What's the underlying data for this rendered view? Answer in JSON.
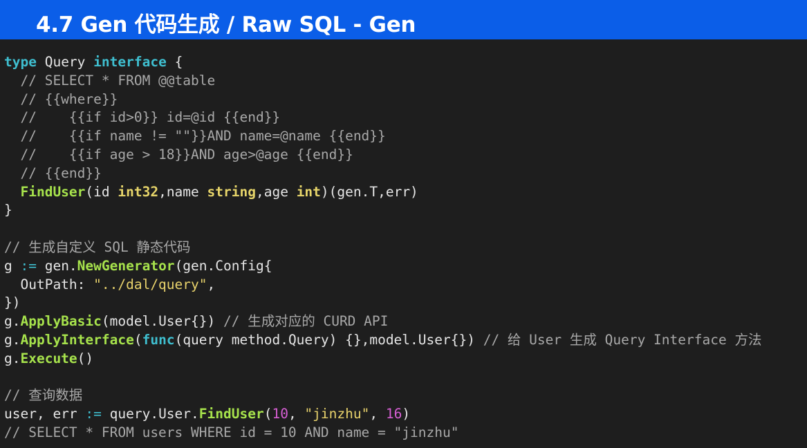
{
  "slide": {
    "title": "4.7 Gen 代码生成 / Raw SQL - Gen"
  },
  "colors": {
    "title_bar": "#0b5ee8",
    "background": "#1e1e1e",
    "keyword": "#3fbfd0",
    "type": "#e7d56a",
    "function": "#a7e34c",
    "comment": "#a9a9a9",
    "string": "#e9d36c",
    "number": "#d75fd4"
  },
  "code": {
    "lines": [
      [
        {
          "t": "kw",
          "v": "type"
        },
        {
          "t": "pl",
          "v": " Query "
        },
        {
          "t": "kw",
          "v": "interface"
        },
        {
          "t": "pl",
          "v": " {"
        }
      ],
      [
        {
          "t": "com",
          "v": "  // SELECT * FROM @@table"
        }
      ],
      [
        {
          "t": "com",
          "v": "  // {{where}}"
        }
      ],
      [
        {
          "t": "com",
          "v": "  //    {{if id>0}} id=@id {{end}}"
        }
      ],
      [
        {
          "t": "com",
          "v": "  //    {{if name != \"\"}}AND name=@name {{end}}"
        }
      ],
      [
        {
          "t": "com",
          "v": "  //    {{if age > 18}}AND age>@age {{end}}"
        }
      ],
      [
        {
          "t": "com",
          "v": "  // {{end}}"
        }
      ],
      [
        {
          "t": "pl",
          "v": "  "
        },
        {
          "t": "fn",
          "v": "FindUser"
        },
        {
          "t": "pl",
          "v": "(id "
        },
        {
          "t": "typ",
          "v": "int32"
        },
        {
          "t": "pl",
          "v": ",name "
        },
        {
          "t": "typ",
          "v": "string"
        },
        {
          "t": "pl",
          "v": ",age "
        },
        {
          "t": "typ",
          "v": "int"
        },
        {
          "t": "pl",
          "v": ")(gen.T,err)"
        }
      ],
      [
        {
          "t": "pl",
          "v": "}"
        }
      ],
      [
        {
          "t": "pl",
          "v": ""
        }
      ],
      [
        {
          "t": "com",
          "v": "// 生成自定义 SQL 静态代码"
        }
      ],
      [
        {
          "t": "pl",
          "v": "g "
        },
        {
          "t": "op",
          "v": ":="
        },
        {
          "t": "pl",
          "v": " gen."
        },
        {
          "t": "fn",
          "v": "NewGenerator"
        },
        {
          "t": "pl",
          "v": "(gen.Config{"
        }
      ],
      [
        {
          "t": "pl",
          "v": "  OutPath: "
        },
        {
          "t": "str",
          "v": "\"../dal/query\""
        },
        {
          "t": "pl",
          "v": ","
        }
      ],
      [
        {
          "t": "pl",
          "v": "})"
        }
      ],
      [
        {
          "t": "pl",
          "v": "g."
        },
        {
          "t": "fn",
          "v": "ApplyBasic"
        },
        {
          "t": "pl",
          "v": "(model.User{}) "
        },
        {
          "t": "com",
          "v": "// 生成对应的 CURD API"
        }
      ],
      [
        {
          "t": "pl",
          "v": "g."
        },
        {
          "t": "fn",
          "v": "ApplyInterface"
        },
        {
          "t": "pl",
          "v": "("
        },
        {
          "t": "kw",
          "v": "func"
        },
        {
          "t": "pl",
          "v": "(query method.Query) {},model.User{}) "
        },
        {
          "t": "com",
          "v": "// 给 User 生成 Query Interface 方法"
        }
      ],
      [
        {
          "t": "pl",
          "v": "g."
        },
        {
          "t": "fn",
          "v": "Execute"
        },
        {
          "t": "pl",
          "v": "()"
        }
      ],
      [
        {
          "t": "pl",
          "v": ""
        }
      ],
      [
        {
          "t": "com",
          "v": "// 查询数据"
        }
      ],
      [
        {
          "t": "pl",
          "v": "user, err "
        },
        {
          "t": "op",
          "v": ":="
        },
        {
          "t": "pl",
          "v": " query.User."
        },
        {
          "t": "fn",
          "v": "FindUser"
        },
        {
          "t": "pl",
          "v": "("
        },
        {
          "t": "num",
          "v": "10"
        },
        {
          "t": "pl",
          "v": ", "
        },
        {
          "t": "str",
          "v": "\"jinzhu\""
        },
        {
          "t": "pl",
          "v": ", "
        },
        {
          "t": "num",
          "v": "16"
        },
        {
          "t": "pl",
          "v": ")"
        }
      ],
      [
        {
          "t": "com",
          "v": "// SELECT * FROM users WHERE id = 10 AND name = \"jinzhu\""
        }
      ]
    ]
  }
}
